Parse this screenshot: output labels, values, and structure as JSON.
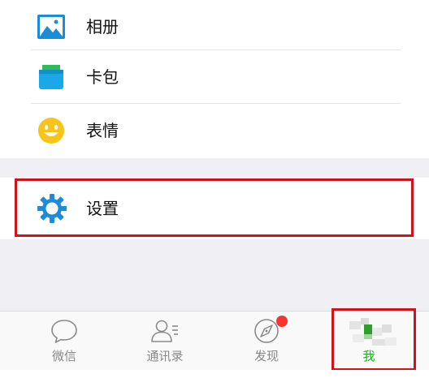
{
  "menu": {
    "items": [
      {
        "label": "相册",
        "icon": "photo-album-icon"
      },
      {
        "label": "卡包",
        "icon": "card-wallet-icon"
      },
      {
        "label": "表情",
        "icon": "emoji-icon"
      }
    ],
    "settings": {
      "label": "设置",
      "icon": "gear-icon"
    }
  },
  "tabbar": {
    "tabs": [
      {
        "label": "微信",
        "icon": "chat-bubble-icon"
      },
      {
        "label": "通讯录",
        "icon": "contacts-icon"
      },
      {
        "label": "发现",
        "icon": "compass-icon"
      },
      {
        "label": "我",
        "icon": "me-icon"
      }
    ],
    "active_tab": "我"
  },
  "colors": {
    "accent_green": "#1aad19",
    "highlight_red": "#d0121b",
    "badge_red": "#f43530",
    "gear_blue": "#1a8cd8",
    "background_gray": "#efeff4"
  }
}
